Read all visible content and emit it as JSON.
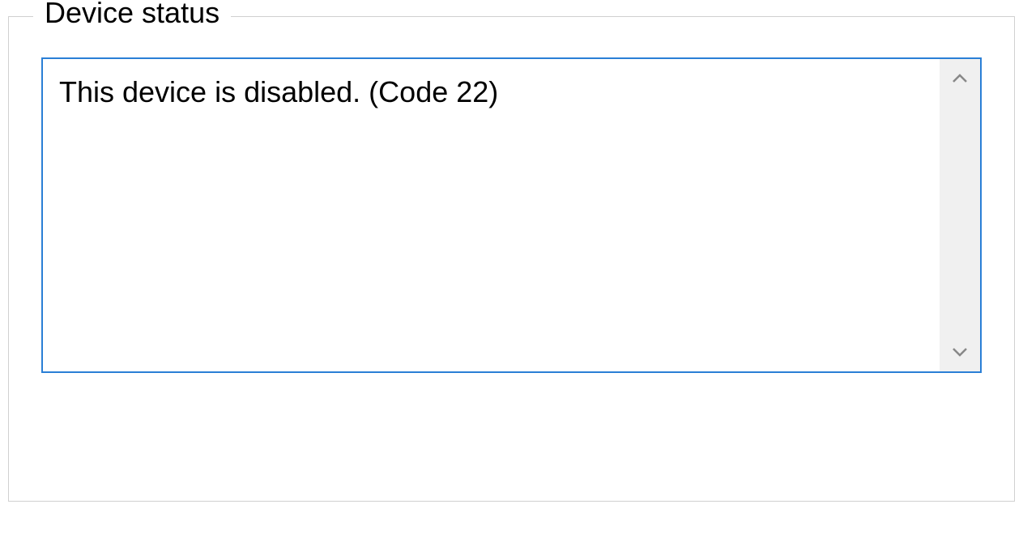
{
  "group": {
    "legend": "Device status"
  },
  "status": {
    "message": "This device is disabled. (Code 22)"
  },
  "colors": {
    "border_focus": "#2a7fd6",
    "scrollbar_bg": "#f0f0f0",
    "scroll_arrow": "#888888",
    "group_border": "#d0d0d0"
  }
}
